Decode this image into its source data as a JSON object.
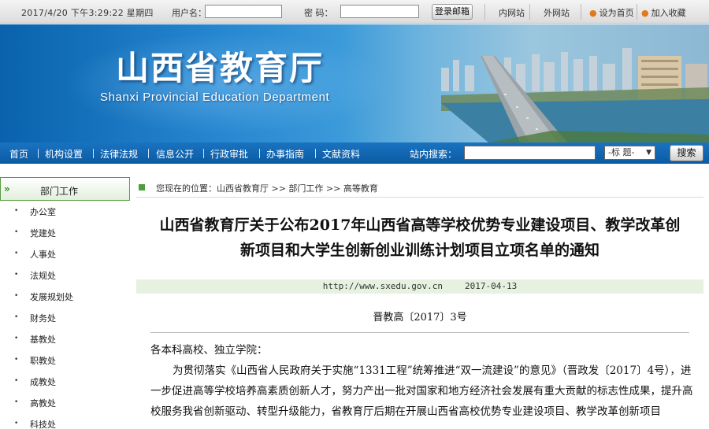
{
  "topbar": {
    "datetime": "2017/4/20 下午3:29:22 星期四",
    "username_label": "用户名：",
    "password_label": "密 码：",
    "mail_login": "登录邮箱",
    "intranet": "内网站",
    "extranet": "外网站",
    "set_home": "设为首页",
    "add_favorite": "加入收藏"
  },
  "banner": {
    "title_cn": "山西省教育厅",
    "title_en": "Shanxi Provincial Education Department"
  },
  "nav": {
    "items": [
      "首页",
      "机构设置",
      "法律法规",
      "信息公开",
      "行政审批",
      "办事指南",
      "文献资料"
    ],
    "search_label": "站内搜索：",
    "select_value": "-标 题-",
    "search_button": "搜索"
  },
  "sidebar": {
    "header": "部门工作",
    "items": [
      "办公室",
      "党建处",
      "人事处",
      "法规处",
      "发展规划处",
      "财务处",
      "基教处",
      "职教处",
      "成教处",
      "高教处",
      "科技处"
    ]
  },
  "breadcrumb": "您现在的位置：山西省教育厅 >> 部门工作 >> 高等教育",
  "article": {
    "title_line1": "山西省教育厅关于公布2017年山西省高等学校优势专业建设项目、教学改革创",
    "title_line2": "新项目和大学生创新创业训练计划项目立项名单的通知",
    "source_url": "http://www.sxedu.gov.cn",
    "date": "2017-04-13",
    "doc_number": "晋教高〔2017〕3号",
    "salutation": "各本科高校、独立学院：",
    "para1": "为贯彻落实《山西省人民政府关于实施“1331工程”统筹推进“双一流建设”的意见》（晋政发〔2017〕4号），进一步促进高等学校培养高素质创新人才，努力产出一批对国家和地方经济社会发展有重大贡献的标志性成果，提升高校服务我省创新驱动、转型升级能力，省教育厅后期在开展山西省高校优势专业建设项目、教学改革创新项目"
  }
}
